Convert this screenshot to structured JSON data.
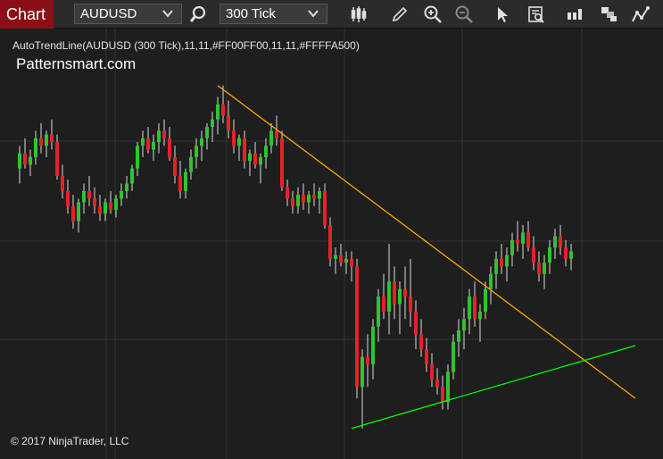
{
  "toolbar": {
    "chart_tab_label": "Chart",
    "instrument": "AUDUSD",
    "interval": "300 Tick",
    "icons": [
      "search-icon",
      "bar-style-icon",
      "pencil-icon",
      "zoom-in-icon",
      "zoom-out-icon",
      "pointer-icon",
      "data-box-icon",
      "properties-icon",
      "templates-icon",
      "strategy-icon"
    ]
  },
  "chart": {
    "indicator_label": "AutoTrendLine(AUDUSD (300 Tick),11,11,#FF00FF00,11,11,#FFFFA500)",
    "brand": "Patternsmart.com",
    "copyright": "© 2017 NinjaTrader, LLC",
    "colors": {
      "background": "#1e1e1e",
      "grid": "#333333",
      "up_candle": "#2ec42e",
      "down_candle": "#e8202a",
      "wick": "#d9d9d9",
      "resistance_line": "#ffa500",
      "support_line": "#00ff00"
    }
  },
  "chart_data": {
    "type": "candlestick",
    "title": "",
    "xlabel": "",
    "ylabel": "",
    "ylim": [
      0,
      100
    ],
    "candles": [
      {
        "o": 70,
        "h": 76,
        "l": 66,
        "c": 74
      },
      {
        "o": 74,
        "h": 78,
        "l": 70,
        "c": 71
      },
      {
        "o": 71,
        "h": 75,
        "l": 68,
        "c": 73
      },
      {
        "o": 73,
        "h": 80,
        "l": 71,
        "c": 78
      },
      {
        "o": 78,
        "h": 82,
        "l": 74,
        "c": 76
      },
      {
        "o": 76,
        "h": 80,
        "l": 73,
        "c": 79
      },
      {
        "o": 79,
        "h": 83,
        "l": 75,
        "c": 77
      },
      {
        "o": 77,
        "h": 79,
        "l": 67,
        "c": 68
      },
      {
        "o": 68,
        "h": 71,
        "l": 62,
        "c": 64
      },
      {
        "o": 64,
        "h": 67,
        "l": 58,
        "c": 60
      },
      {
        "o": 60,
        "h": 63,
        "l": 54,
        "c": 56
      },
      {
        "o": 56,
        "h": 62,
        "l": 53,
        "c": 61
      },
      {
        "o": 61,
        "h": 66,
        "l": 58,
        "c": 64
      },
      {
        "o": 64,
        "h": 68,
        "l": 60,
        "c": 62
      },
      {
        "o": 62,
        "h": 65,
        "l": 58,
        "c": 60
      },
      {
        "o": 60,
        "h": 63,
        "l": 56,
        "c": 58
      },
      {
        "o": 58,
        "h": 62,
        "l": 56,
        "c": 61
      },
      {
        "o": 61,
        "h": 64,
        "l": 58,
        "c": 59
      },
      {
        "o": 59,
        "h": 63,
        "l": 57,
        "c": 62
      },
      {
        "o": 62,
        "h": 66,
        "l": 60,
        "c": 64
      },
      {
        "o": 64,
        "h": 68,
        "l": 62,
        "c": 66
      },
      {
        "o": 66,
        "h": 71,
        "l": 64,
        "c": 70
      },
      {
        "o": 70,
        "h": 77,
        "l": 68,
        "c": 76
      },
      {
        "o": 76,
        "h": 80,
        "l": 73,
        "c": 78
      },
      {
        "o": 78,
        "h": 81,
        "l": 74,
        "c": 75
      },
      {
        "o": 75,
        "h": 79,
        "l": 72,
        "c": 77
      },
      {
        "o": 77,
        "h": 82,
        "l": 74,
        "c": 80
      },
      {
        "o": 80,
        "h": 83,
        "l": 76,
        "c": 78
      },
      {
        "o": 78,
        "h": 81,
        "l": 72,
        "c": 73
      },
      {
        "o": 73,
        "h": 76,
        "l": 66,
        "c": 68
      },
      {
        "o": 68,
        "h": 72,
        "l": 62,
        "c": 64
      },
      {
        "o": 64,
        "h": 70,
        "l": 62,
        "c": 69
      },
      {
        "o": 69,
        "h": 75,
        "l": 67,
        "c": 73
      },
      {
        "o": 73,
        "h": 78,
        "l": 70,
        "c": 76
      },
      {
        "o": 76,
        "h": 80,
        "l": 72,
        "c": 78
      },
      {
        "o": 78,
        "h": 82,
        "l": 75,
        "c": 81
      },
      {
        "o": 81,
        "h": 85,
        "l": 77,
        "c": 83
      },
      {
        "o": 83,
        "h": 89,
        "l": 79,
        "c": 87
      },
      {
        "o": 87,
        "h": 92,
        "l": 82,
        "c": 84
      },
      {
        "o": 84,
        "h": 88,
        "l": 78,
        "c": 80
      },
      {
        "o": 80,
        "h": 83,
        "l": 74,
        "c": 76
      },
      {
        "o": 76,
        "h": 79,
        "l": 72,
        "c": 78
      },
      {
        "o": 78,
        "h": 80,
        "l": 70,
        "c": 72
      },
      {
        "o": 72,
        "h": 75,
        "l": 68,
        "c": 74
      },
      {
        "o": 74,
        "h": 77,
        "l": 70,
        "c": 71
      },
      {
        "o": 71,
        "h": 74,
        "l": 66,
        "c": 73
      },
      {
        "o": 73,
        "h": 78,
        "l": 70,
        "c": 76
      },
      {
        "o": 76,
        "h": 82,
        "l": 74,
        "c": 80
      },
      {
        "o": 80,
        "h": 84,
        "l": 76,
        "c": 78
      },
      {
        "o": 78,
        "h": 80,
        "l": 64,
        "c": 65
      },
      {
        "o": 65,
        "h": 67,
        "l": 60,
        "c": 62
      },
      {
        "o": 62,
        "h": 64,
        "l": 58,
        "c": 60
      },
      {
        "o": 60,
        "h": 65,
        "l": 58,
        "c": 63
      },
      {
        "o": 63,
        "h": 66,
        "l": 59,
        "c": 61
      },
      {
        "o": 61,
        "h": 64,
        "l": 58,
        "c": 63
      },
      {
        "o": 63,
        "h": 66,
        "l": 60,
        "c": 62
      },
      {
        "o": 62,
        "h": 65,
        "l": 58,
        "c": 64
      },
      {
        "o": 64,
        "h": 66,
        "l": 54,
        "c": 55
      },
      {
        "o": 55,
        "h": 57,
        "l": 44,
        "c": 46
      },
      {
        "o": 46,
        "h": 49,
        "l": 42,
        "c": 47
      },
      {
        "o": 47,
        "h": 50,
        "l": 44,
        "c": 45
      },
      {
        "o": 45,
        "h": 48,
        "l": 42,
        "c": 46
      },
      {
        "o": 46,
        "h": 48,
        "l": 40,
        "c": 44
      },
      {
        "o": 44,
        "h": 46,
        "l": 9,
        "c": 12
      },
      {
        "o": 12,
        "h": 22,
        "l": 1,
        "c": 20
      },
      {
        "o": 20,
        "h": 26,
        "l": 12,
        "c": 18
      },
      {
        "o": 18,
        "h": 30,
        "l": 14,
        "c": 28
      },
      {
        "o": 28,
        "h": 38,
        "l": 24,
        "c": 36
      },
      {
        "o": 36,
        "h": 42,
        "l": 30,
        "c": 32
      },
      {
        "o": 32,
        "h": 50,
        "l": 26,
        "c": 40
      },
      {
        "o": 40,
        "h": 44,
        "l": 30,
        "c": 34
      },
      {
        "o": 34,
        "h": 40,
        "l": 26,
        "c": 38
      },
      {
        "o": 38,
        "h": 44,
        "l": 30,
        "c": 36
      },
      {
        "o": 36,
        "h": 46,
        "l": 28,
        "c": 32
      },
      {
        "o": 32,
        "h": 35,
        "l": 22,
        "c": 26
      },
      {
        "o": 26,
        "h": 30,
        "l": 20,
        "c": 22
      },
      {
        "o": 22,
        "h": 25,
        "l": 16,
        "c": 18
      },
      {
        "o": 18,
        "h": 21,
        "l": 12,
        "c": 14
      },
      {
        "o": 14,
        "h": 17,
        "l": 10,
        "c": 12
      },
      {
        "o": 12,
        "h": 15,
        "l": 6,
        "c": 8
      },
      {
        "o": 8,
        "h": 18,
        "l": 6,
        "c": 16
      },
      {
        "o": 16,
        "h": 26,
        "l": 14,
        "c": 24
      },
      {
        "o": 24,
        "h": 30,
        "l": 20,
        "c": 27
      },
      {
        "o": 27,
        "h": 33,
        "l": 22,
        "c": 30
      },
      {
        "o": 30,
        "h": 38,
        "l": 26,
        "c": 36
      },
      {
        "o": 36,
        "h": 40,
        "l": 28,
        "c": 30
      },
      {
        "o": 30,
        "h": 34,
        "l": 24,
        "c": 32
      },
      {
        "o": 32,
        "h": 40,
        "l": 30,
        "c": 38
      },
      {
        "o": 38,
        "h": 44,
        "l": 34,
        "c": 42
      },
      {
        "o": 42,
        "h": 48,
        "l": 38,
        "c": 46
      },
      {
        "o": 46,
        "h": 50,
        "l": 42,
        "c": 44
      },
      {
        "o": 44,
        "h": 49,
        "l": 40,
        "c": 47
      },
      {
        "o": 47,
        "h": 53,
        "l": 44,
        "c": 51
      },
      {
        "o": 51,
        "h": 56,
        "l": 48,
        "c": 50
      },
      {
        "o": 50,
        "h": 55,
        "l": 46,
        "c": 53
      },
      {
        "o": 53,
        "h": 56,
        "l": 48,
        "c": 49
      },
      {
        "o": 49,
        "h": 52,
        "l": 43,
        "c": 45
      },
      {
        "o": 45,
        "h": 48,
        "l": 40,
        "c": 42
      },
      {
        "o": 42,
        "h": 47,
        "l": 38,
        "c": 45
      },
      {
        "o": 45,
        "h": 51,
        "l": 42,
        "c": 49
      },
      {
        "o": 49,
        "h": 54,
        "l": 46,
        "c": 52
      },
      {
        "o": 52,
        "h": 55,
        "l": 47,
        "c": 49
      },
      {
        "o": 49,
        "h": 51,
        "l": 44,
        "c": 46
      },
      {
        "o": 46,
        "h": 50,
        "l": 43,
        "c": 48
      }
    ],
    "trendlines": [
      {
        "name": "resistance",
        "color": "#ffa500",
        "from": {
          "bar": 37,
          "y": 92
        },
        "to": {
          "bar": 115,
          "y": 9
        }
      },
      {
        "name": "support",
        "color": "#00ff00",
        "from": {
          "bar": 62,
          "y": 1
        },
        "to": {
          "bar": 115,
          "y": 23
        }
      }
    ]
  }
}
